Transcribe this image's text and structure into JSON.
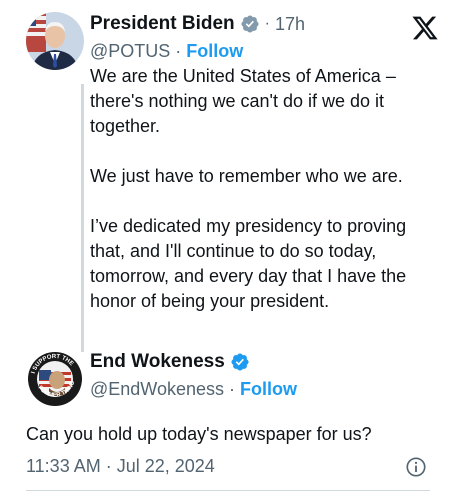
{
  "parent_tweet": {
    "author_name": "President Biden",
    "time": "17h",
    "handle": "@POTUS",
    "separator": "·",
    "follow_label": "Follow",
    "paragraphs": [
      "We are the United States of America – there's nothing we can't do if we do it together.",
      "We just have to remember who we are.",
      "I’ve dedicated my presidency to proving that, and I'll continue to do so today, tomorrow, and every day that I have the honor of being your president."
    ]
  },
  "reply_tweet": {
    "author_name": "End Wokeness",
    "handle": "@EndWokeness",
    "separator": "·",
    "follow_label": "Follow",
    "text": "Can you hold up today's newspaper for us?",
    "timestamp": "11:33 AM · Jul 22, 2024",
    "avatar_text": "I SUPPORT THE FORMER THINGS"
  },
  "icons": {
    "verified": "verified-badge-icon",
    "x_logo": "x-logo-icon",
    "info": "info-icon"
  },
  "colors": {
    "accent": "#1d9bf0",
    "secondary_text": "#536471",
    "primary_text": "#0f1419",
    "line": "#cfd9de"
  }
}
